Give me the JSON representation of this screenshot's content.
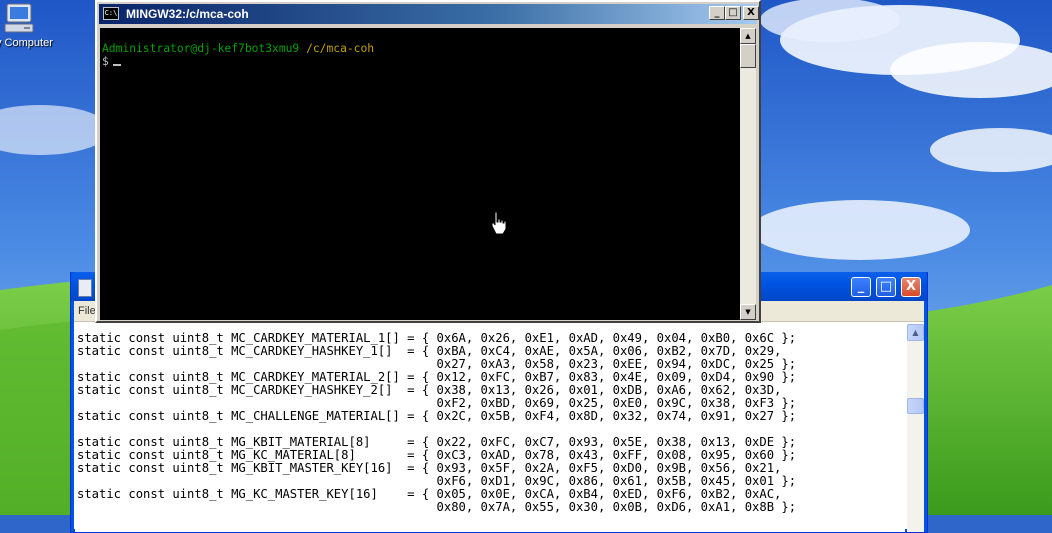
{
  "desktop": {
    "icon_label": "y Computer",
    "icon_name": "my-computer-icon"
  },
  "terminal": {
    "title": "MINGW32:/c/mca-coh",
    "icon_name": "console-icon",
    "icon_text": "C:\\",
    "user_host": "Administrator@dj-kef7bot3xmu9",
    "path": "/c/mca-coh",
    "prompt": "$",
    "buttons": {
      "minimize": "_",
      "maximize": "□",
      "close": "X"
    }
  },
  "editor": {
    "menu_first": "File",
    "code_lines": [
      "static const uint8_t MC_CARDKEY_MATERIAL_1[] = { 0x6A, 0x26, 0xE1, 0xAD, 0x49, 0x04, 0xB0, 0x6C };",
      "static const uint8_t MC_CARDKEY_HASHKEY_1[]  = { 0xBA, 0xC4, 0xAE, 0x5A, 0x06, 0xB2, 0x7D, 0x29,",
      "                                                 0x27, 0xA3, 0x58, 0x23, 0xEE, 0x94, 0xDC, 0x25 };",
      "static const uint8_t MC_CARDKEY_MATERIAL_2[] = { 0x12, 0xFC, 0xB7, 0x83, 0x4E, 0x09, 0xD4, 0x90 };",
      "static const uint8_t MC_CARDKEY_HASHKEY_2[]  = { 0x38, 0x13, 0x26, 0x01, 0xDB, 0xA6, 0x62, 0x3D,",
      "                                                 0xF2, 0xBD, 0x69, 0x25, 0xE0, 0x9C, 0x38, 0xF3 };",
      "static const uint8_t MC_CHALLENGE_MATERIAL[] = { 0x2C, 0x5B, 0xF4, 0x8D, 0x32, 0x74, 0x91, 0x27 };",
      "",
      "static const uint8_t MG_KBIT_MATERIAL[8]     = { 0x22, 0xFC, 0xC7, 0x93, 0x5E, 0x38, 0x13, 0xDE };",
      "static const uint8_t MG_KC_MATERIAL[8]       = { 0xC3, 0xAD, 0x78, 0x43, 0xFF, 0x08, 0x95, 0x60 };",
      "static const uint8_t MG_KBIT_MASTER_KEY[16]  = { 0x93, 0x5F, 0x2A, 0xF5, 0xD0, 0x9B, 0x56, 0x21,",
      "                                                 0xF6, 0xD1, 0x9C, 0x86, 0x61, 0x5B, 0x45, 0x01 };",
      "static const uint8_t MG_KC_MASTER_KEY[16]    = { 0x05, 0x0E, 0xCA, 0xB4, 0xED, 0xF6, 0xB2, 0xAC,",
      "                                                 0x80, 0x7A, 0x55, 0x30, 0x0B, 0xD6, 0xA1, 0x8B };"
    ],
    "buttons": {
      "minimize": "_",
      "maximize": "□",
      "close": "X"
    }
  },
  "colors": {
    "xp_title_blue": "#0054e3",
    "console_green": "#00a000",
    "console_yellow": "#c0a000",
    "console_bg": "#000000"
  }
}
